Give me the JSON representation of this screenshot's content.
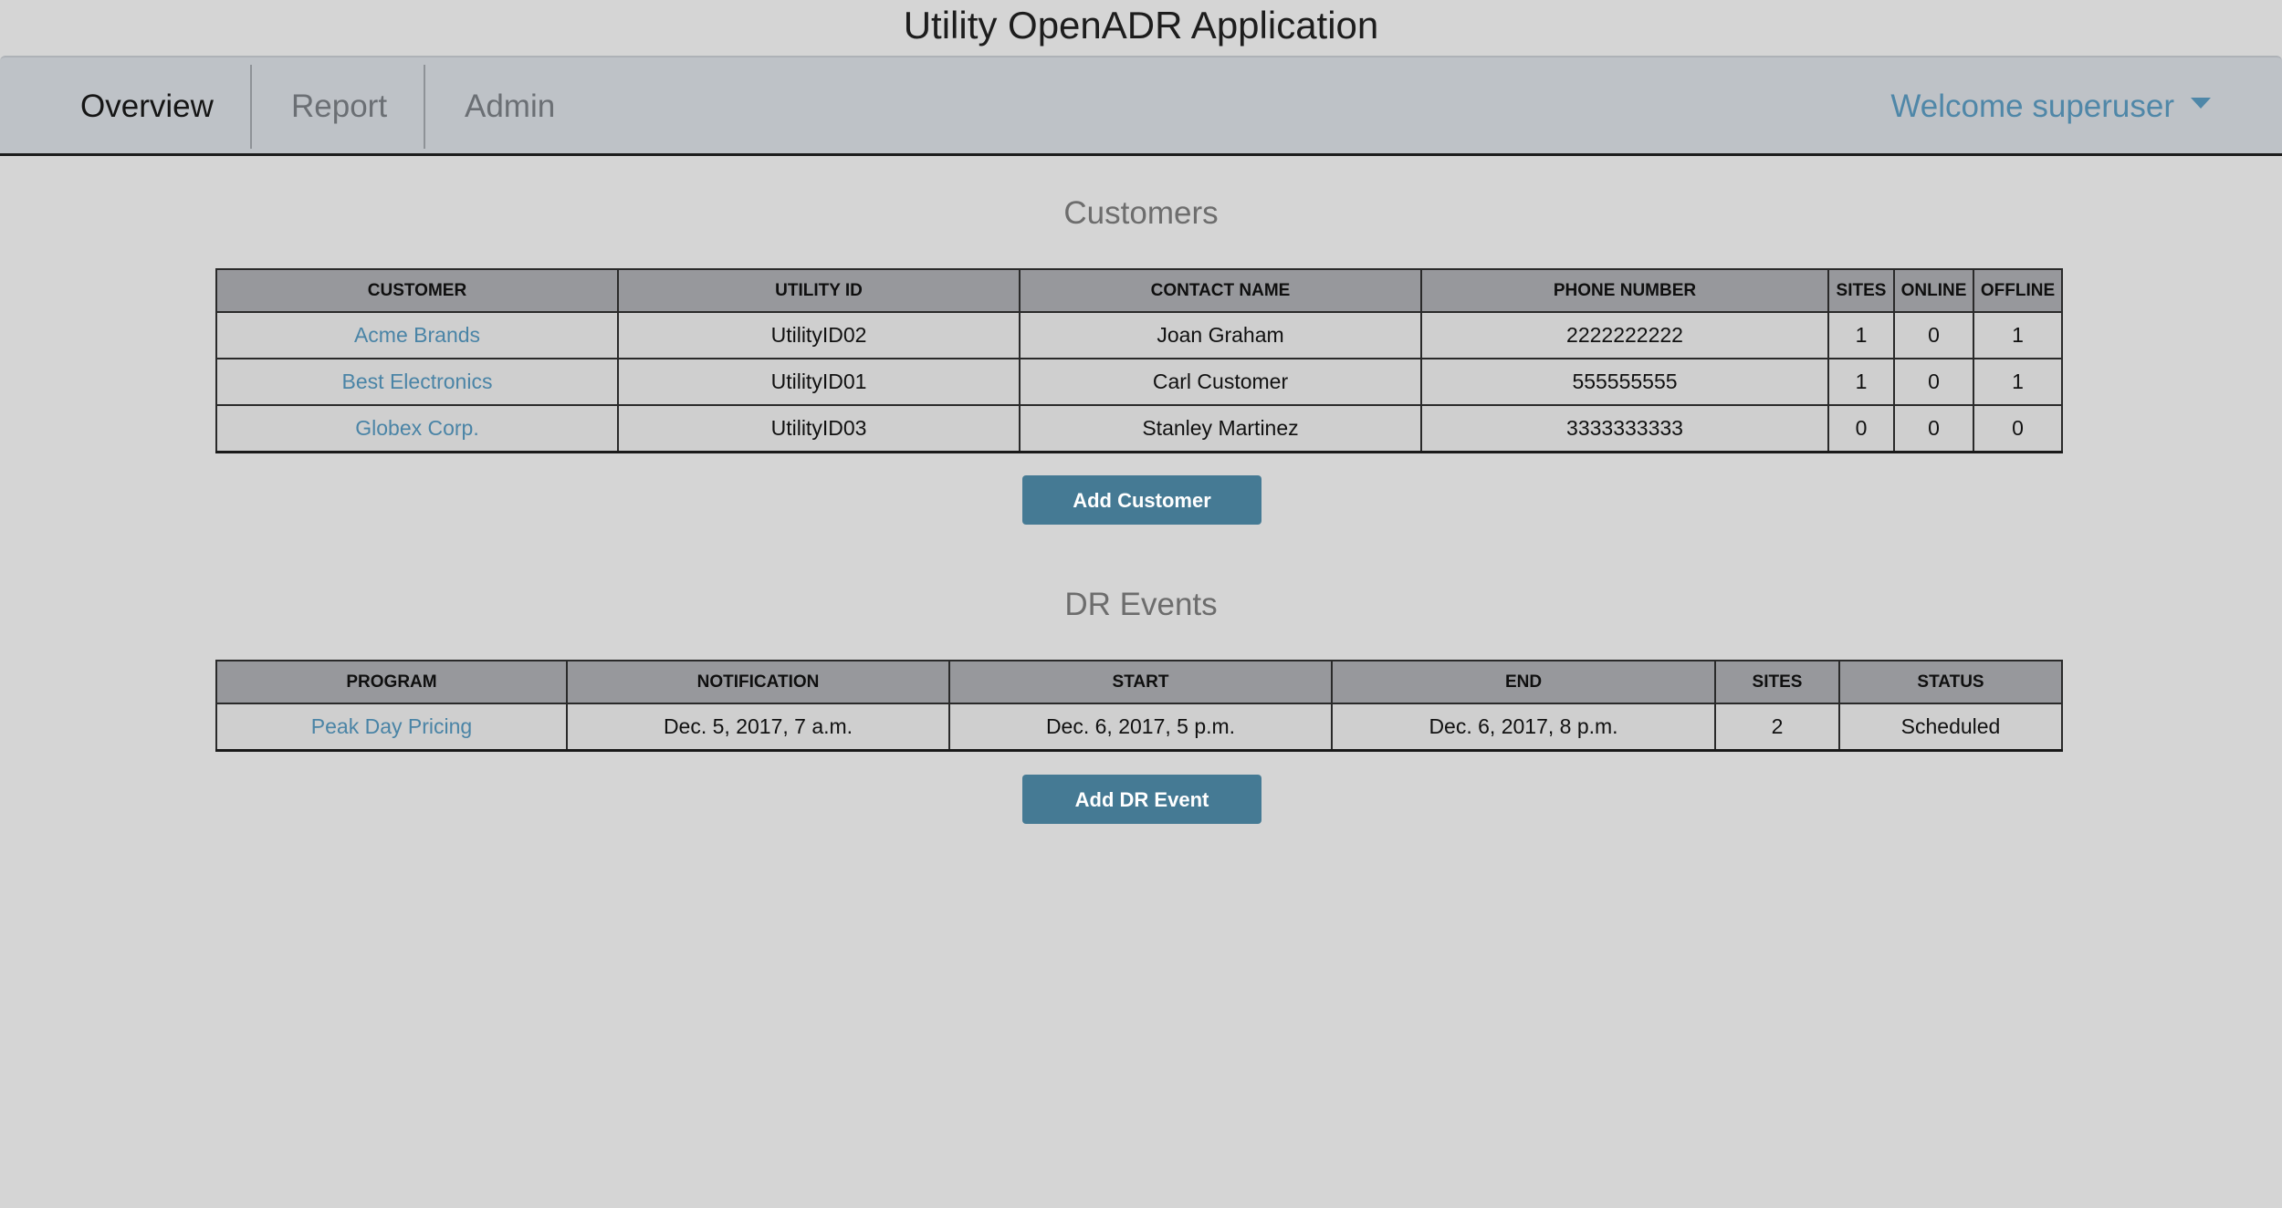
{
  "app": {
    "title": "Utility OpenADR Application"
  },
  "nav": {
    "tabs": [
      {
        "label": "Overview",
        "active": true
      },
      {
        "label": "Report",
        "active": false
      },
      {
        "label": "Admin",
        "active": false
      }
    ],
    "user_menu": "Welcome superuser"
  },
  "customers": {
    "title": "Customers",
    "columns": [
      "CUSTOMER",
      "UTILITY ID",
      "CONTACT NAME",
      "PHONE NUMBER",
      "SITES",
      "ONLINE",
      "OFFLINE"
    ],
    "rows": [
      {
        "customer": "Acme Brands",
        "utility_id": "UtilityID02",
        "contact_name": "Joan Graham",
        "phone": "2222222222",
        "sites": "1",
        "online": "0",
        "offline": "1"
      },
      {
        "customer": "Best Electronics",
        "utility_id": "UtilityID01",
        "contact_name": "Carl Customer",
        "phone": "555555555",
        "sites": "1",
        "online": "0",
        "offline": "1"
      },
      {
        "customer": "Globex Corp.",
        "utility_id": "UtilityID03",
        "contact_name": "Stanley Martinez",
        "phone": "3333333333",
        "sites": "0",
        "online": "0",
        "offline": "0"
      }
    ],
    "add_button": "Add Customer"
  },
  "dr_events": {
    "title": "DR Events",
    "columns": [
      "PROGRAM",
      "NOTIFICATION",
      "START",
      "END",
      "SITES",
      "STATUS"
    ],
    "rows": [
      {
        "program": "Peak Day Pricing",
        "notification": "Dec. 5, 2017, 7 a.m.",
        "start": "Dec. 6, 2017, 5 p.m.",
        "end": "Dec. 6, 2017, 8 p.m.",
        "sites": "2",
        "status": "Scheduled"
      }
    ],
    "add_button": "Add DR Event"
  },
  "colors": {
    "background": "#d5d5d5",
    "navbar": "#bec2c7",
    "link": "#4a84a6",
    "button": "#457a94",
    "table_header": "#97989c"
  }
}
